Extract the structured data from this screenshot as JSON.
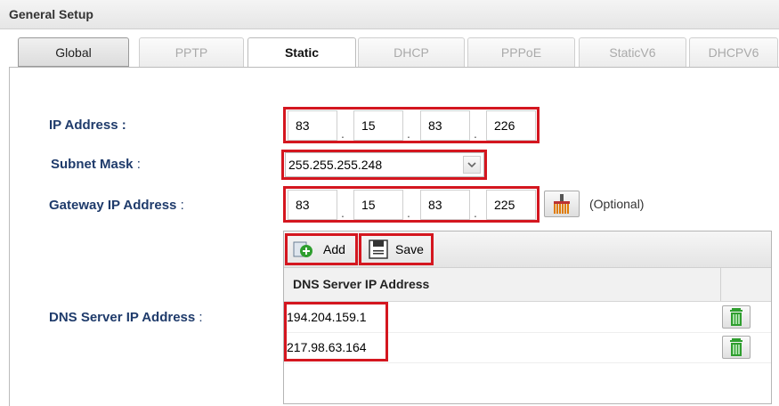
{
  "window": {
    "title": "General Setup"
  },
  "tabs": [
    {
      "label": "Global"
    },
    {
      "label": "PPTP"
    },
    {
      "label": "Static"
    },
    {
      "label": "DHCP"
    },
    {
      "label": "PPPoE"
    },
    {
      "label": "StaticV6"
    },
    {
      "label": "DHCPV6"
    }
  ],
  "form": {
    "ip_label": "IP Address",
    "ip_suffix": " :",
    "ip": [
      "83",
      "15",
      "83",
      "226"
    ],
    "subnet_label": "Subnet Mask",
    "subnet_suffix": " :",
    "subnet_value": "255.255.255.248",
    "gateway_label": "Gateway IP Address",
    "gateway_suffix": " :",
    "gateway": [
      "83",
      "15",
      "83",
      "225"
    ],
    "optional_text": "(Optional)",
    "dns_label": "DNS Server IP Address",
    "dns_suffix": " :"
  },
  "dns_grid": {
    "add_label": "Add",
    "save_label": "Save",
    "column_header": "DNS Server IP Address",
    "rows": [
      "194.204.159.1",
      "217.98.63.164"
    ]
  },
  "colors": {
    "highlight": "#d4161f",
    "label": "#1f3b6b",
    "trash": "#2e9e2e",
    "broom": "#e07b00"
  },
  "icons": {
    "broom": "broom-icon",
    "trash": "trash-icon",
    "add": "add-icon",
    "save": "save-icon",
    "dropdown": "chevron-down-icon"
  }
}
